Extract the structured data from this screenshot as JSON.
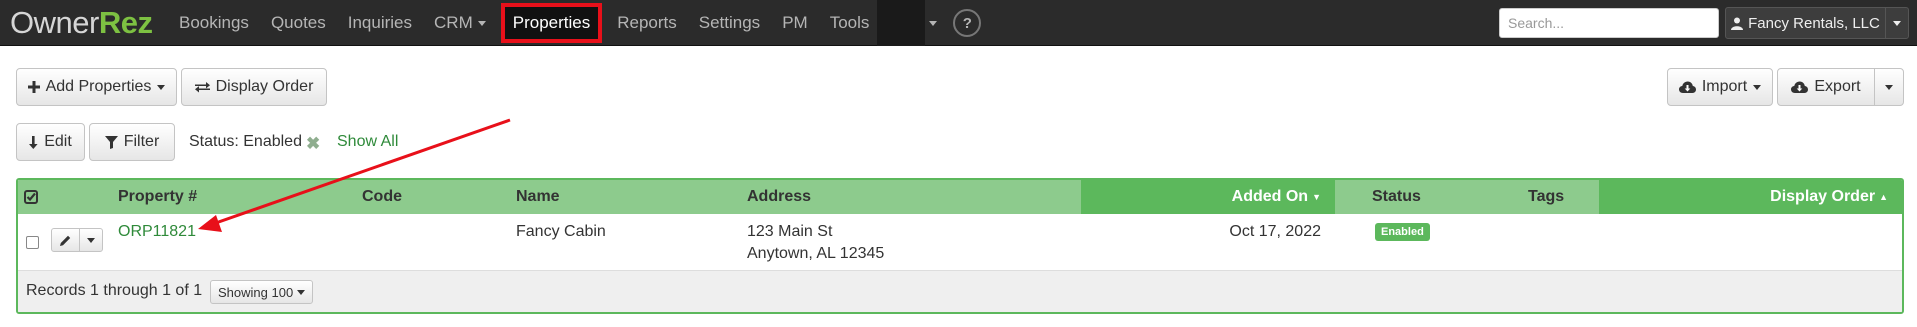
{
  "brand": {
    "owner": "Owner",
    "rez": "Rez"
  },
  "nav": {
    "items": [
      {
        "label": "Bookings"
      },
      {
        "label": "Quotes"
      },
      {
        "label": "Inquiries"
      },
      {
        "label": "CRM"
      },
      {
        "label": "Properties"
      },
      {
        "label": "Reports"
      },
      {
        "label": "Settings"
      },
      {
        "label": "PM"
      },
      {
        "label": "Tools"
      }
    ],
    "active": "Properties",
    "help_label": "?"
  },
  "search": {
    "placeholder": "Search..."
  },
  "account": {
    "name": "Fancy Rentals, LLC",
    "icon": "user-icon"
  },
  "toolbar": {
    "add_properties": "Add Properties",
    "display_order": "Display Order",
    "import": "Import",
    "export": "Export",
    "edit": "Edit",
    "filter": "Filter"
  },
  "filter": {
    "status_label": "Status: Enabled",
    "clear_symbol": "✖",
    "show_all": "Show All"
  },
  "table": {
    "columns": {
      "property_no": "Property #",
      "code": "Code",
      "name": "Name",
      "address": "Address",
      "added_on": "Added On",
      "status": "Status",
      "tags": "Tags",
      "display_order": "Display Order"
    },
    "rows": [
      {
        "property_no": "ORP11821",
        "code": "",
        "name": "Fancy Cabin",
        "address_line1": "123 Main St",
        "address_line2": "Anytown, AL 12345",
        "added_on": "Oct 17, 2022",
        "status": "Enabled",
        "tags": "",
        "display_order": ""
      }
    ],
    "footer": {
      "records": "Records 1 through 1 of 1",
      "showing": "Showing 100"
    }
  },
  "colors": {
    "nav_bg": "#2b2b2b",
    "brand_green": "#7dc142",
    "header_green": "#8dcb8d",
    "sorted_green": "#5cb85c",
    "link_green": "#2f8a3a",
    "annotation_red": "#e8101a"
  }
}
